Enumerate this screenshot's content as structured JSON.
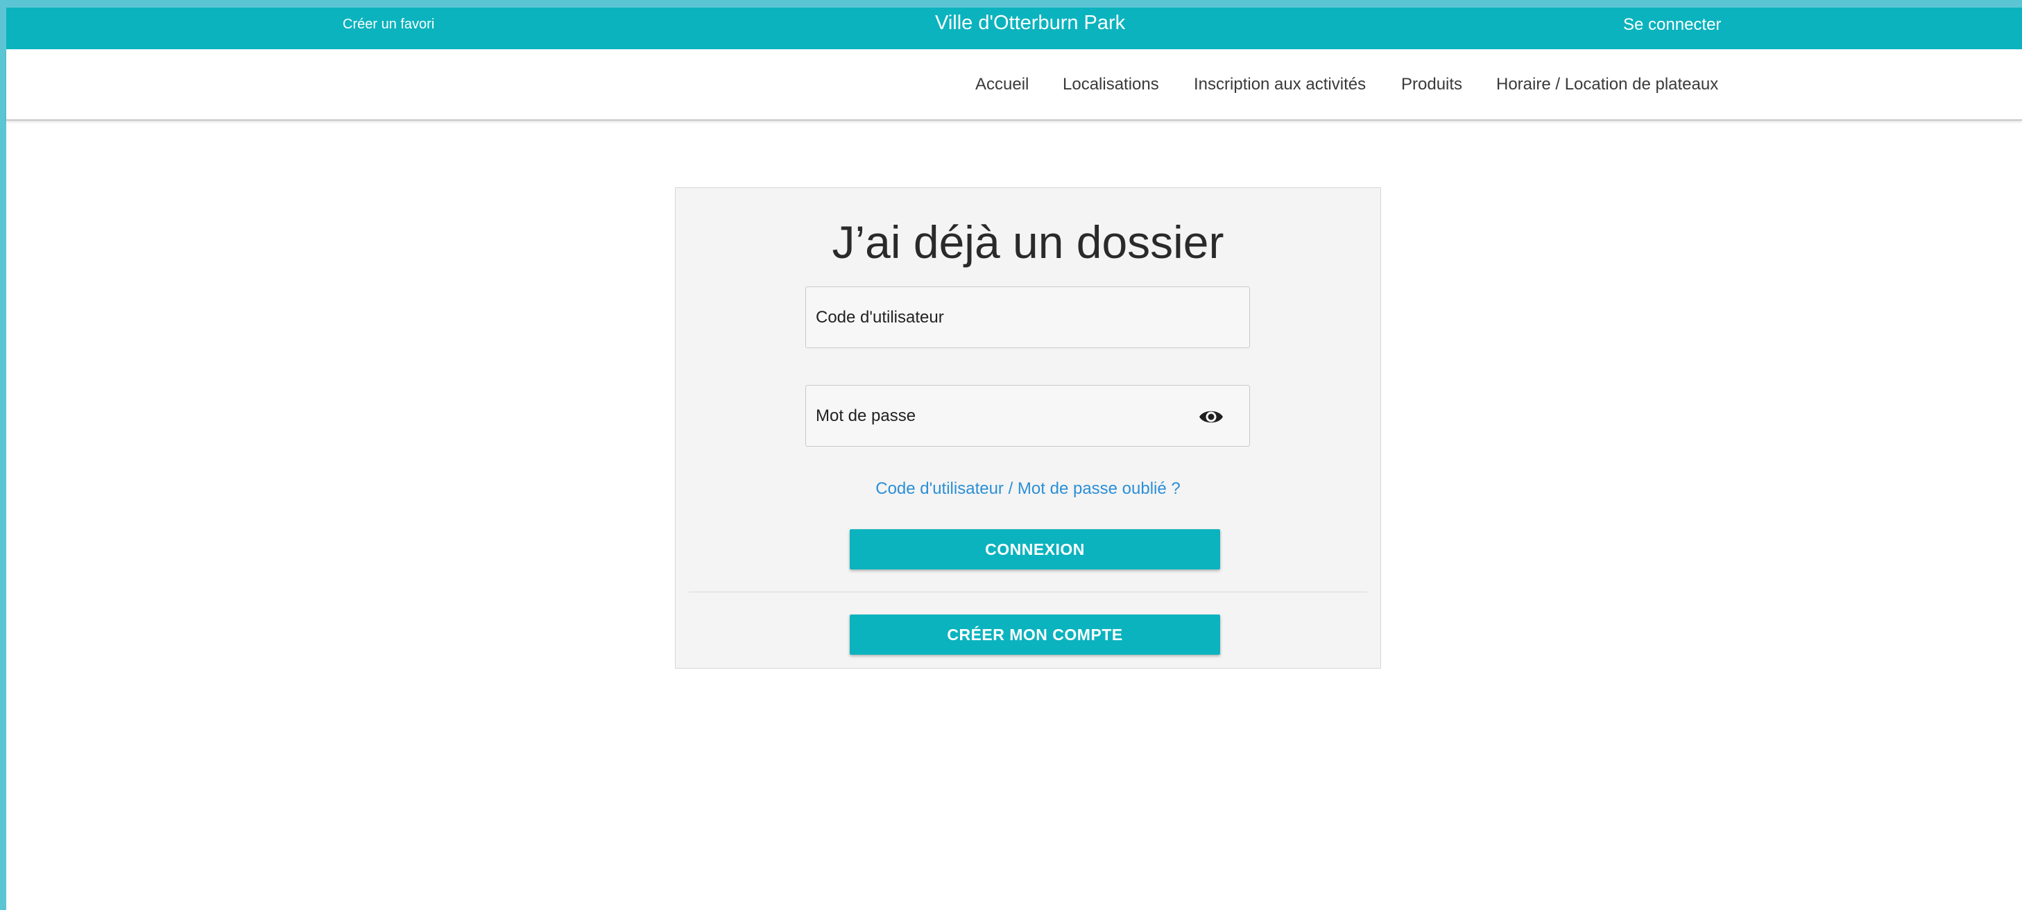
{
  "topbar": {
    "favorite_label": "Créer un favori",
    "site_title": "Ville d'Otterburn Park",
    "login_label": "Se connecter"
  },
  "nav": {
    "items": [
      {
        "label": "Accueil"
      },
      {
        "label": "Localisations"
      },
      {
        "label": "Inscription aux activités"
      },
      {
        "label": "Produits"
      },
      {
        "label": "Horaire / Location de plateaux"
      }
    ]
  },
  "login_card": {
    "title": "J’ai déjà un dossier",
    "username_placeholder": "Code d'utilisateur",
    "password_placeholder": "Mot de passe",
    "password_toggle_icon": "eye-icon",
    "forgot_link": "Code d'utilisateur / Mot de passe oublié ?",
    "login_button": "CONNEXION",
    "create_account_button": "CRÉER MON COMPTE"
  },
  "colors": {
    "brand_teal": "#0bb3be",
    "link_blue": "#2b8fd6",
    "outer_border": "#5bc5d3"
  }
}
